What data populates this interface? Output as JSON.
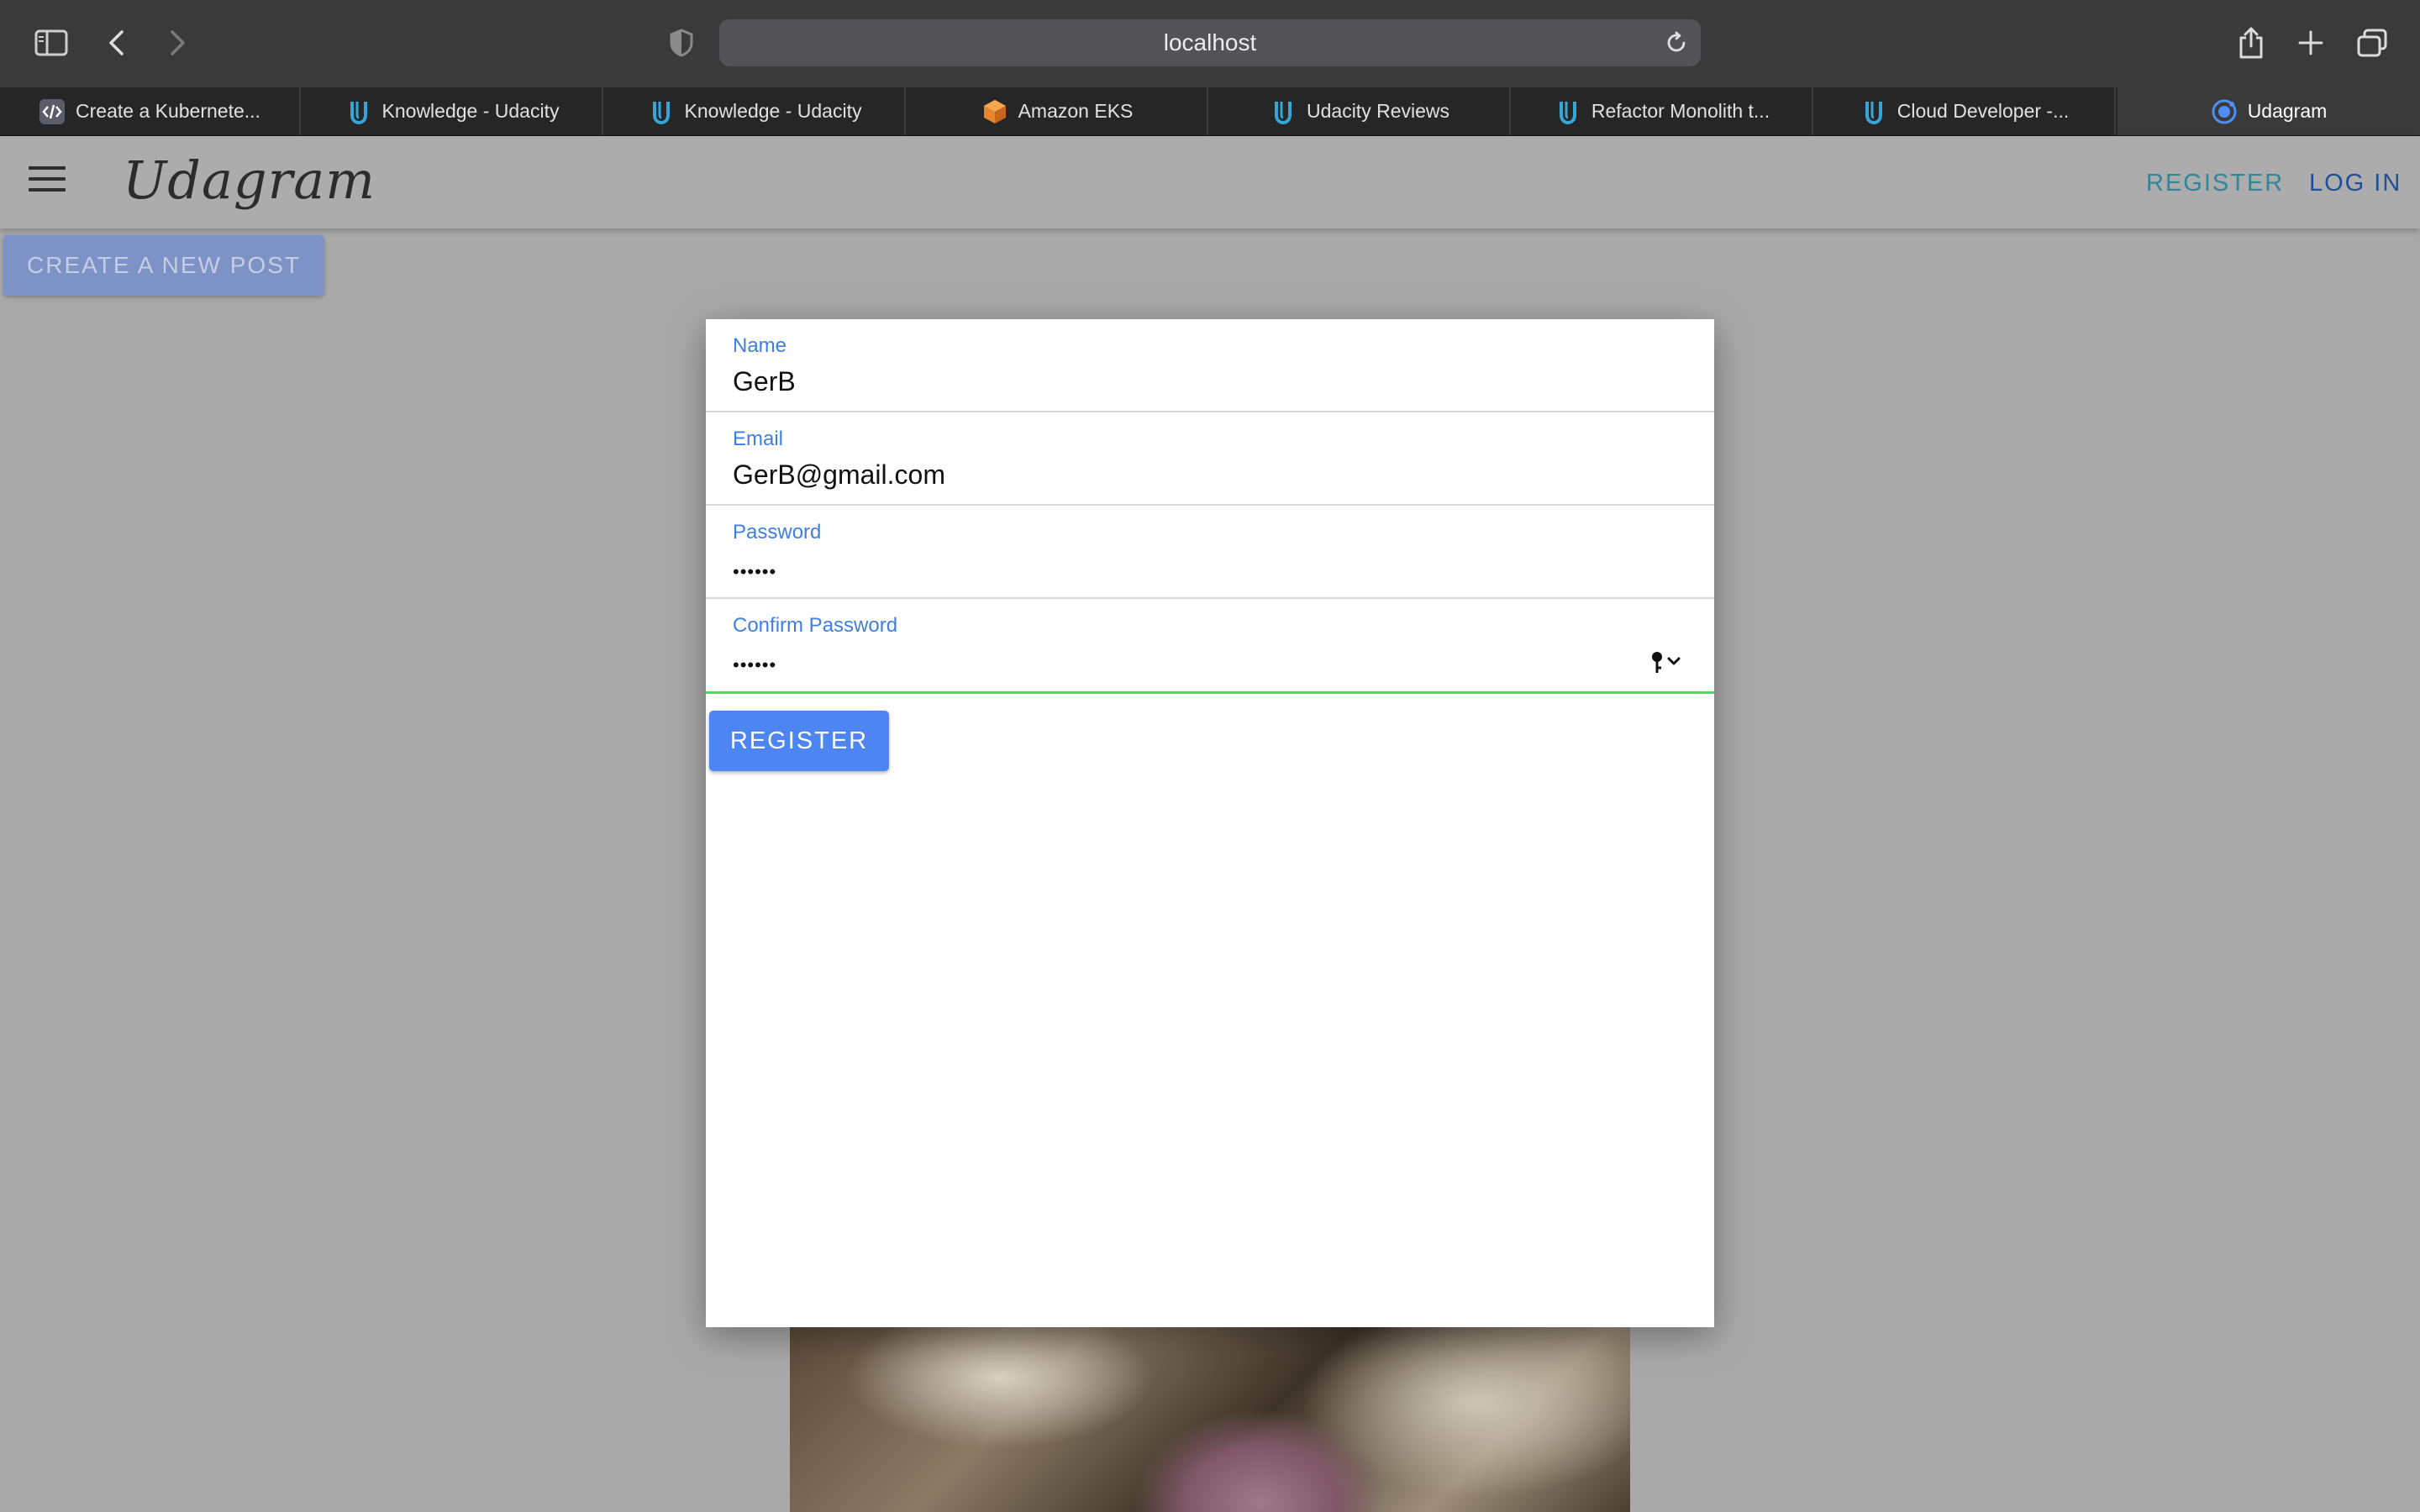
{
  "browser": {
    "url": "localhost",
    "tabs": [
      {
        "label": "Create a Kubernete...",
        "icon": "code-icon"
      },
      {
        "label": "Knowledge - Udacity",
        "icon": "udacity-icon"
      },
      {
        "label": "Knowledge - Udacity",
        "icon": "udacity-icon"
      },
      {
        "label": "Amazon EKS",
        "icon": "aws-cube-icon"
      },
      {
        "label": "Udacity Reviews",
        "icon": "udacity-icon"
      },
      {
        "label": "Refactor Monolith t...",
        "icon": "udacity-icon"
      },
      {
        "label": "Cloud Developer -...",
        "icon": "udacity-icon"
      },
      {
        "label": "Udagram",
        "icon": "ionic-icon",
        "active": true
      }
    ]
  },
  "header": {
    "logo": "Udagram",
    "register_label": "REGISTER",
    "login_label": "LOG IN"
  },
  "create_post_label": "CREATE A NEW POST",
  "form": {
    "name": {
      "label": "Name",
      "value": "GerB"
    },
    "email": {
      "label": "Email",
      "value": "GerB@gmail.com"
    },
    "password": {
      "label": "Password",
      "value": "••••••"
    },
    "confirm_password": {
      "label": "Confirm Password",
      "value": "••••••"
    },
    "submit_label": "REGISTER"
  },
  "colors": {
    "accent_blue": "#4d86f2",
    "label_blue": "#3f7fe0",
    "focus_green": "#4cd964"
  }
}
